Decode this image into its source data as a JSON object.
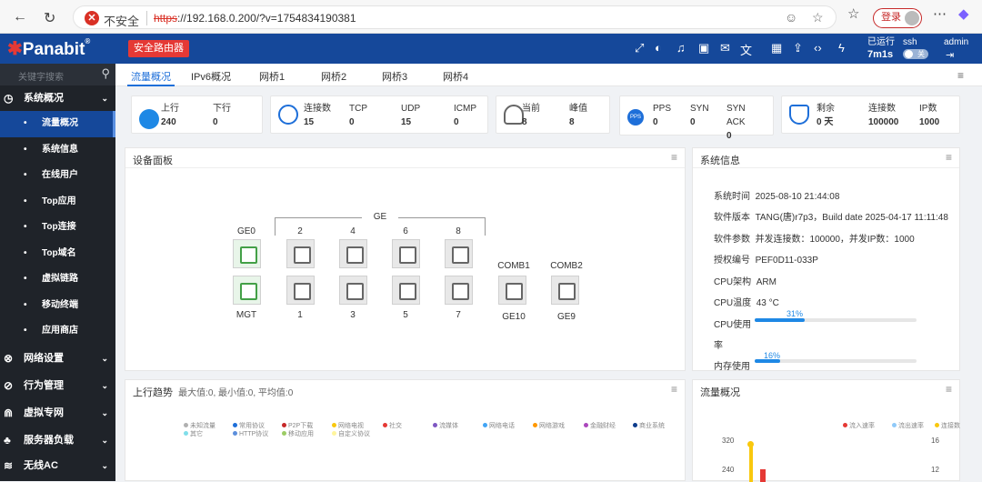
{
  "browser": {
    "insecure_label": "不安全",
    "url_scheme": "https",
    "url_rest": "://192.168.0.200/?v=1754834190381",
    "login_label": "登录"
  },
  "header": {
    "logo": "Panabit",
    "logo_mark": "®",
    "secure_router": "安全路由器",
    "uptime_label": "已运行",
    "uptime_value": "7m1s",
    "ssh_label": "ssh",
    "ssh_toggle": "关",
    "user": "admin"
  },
  "sidebar": {
    "search_placeholder": "关键字搜索",
    "groups": [
      {
        "label": "系统概况",
        "items": [
          "流量概况",
          "系统信息",
          "在线用户",
          "Top应用",
          "Top连接",
          "Top域名",
          "虚拟链路",
          "移动终端",
          "应用商店"
        ]
      },
      {
        "label": "网络设置"
      },
      {
        "label": "行为管理"
      },
      {
        "label": "虚拟专网"
      },
      {
        "label": "服务器负载"
      },
      {
        "label": "无线AC"
      }
    ]
  },
  "tabs": [
    "流量概况",
    "IPv6概况",
    "网桥1",
    "网桥2",
    "网桥3",
    "网桥4"
  ],
  "stats": {
    "traffic": {
      "up_label": "上行",
      "up_value": "240",
      "down_label": "下行",
      "down_value": "0"
    },
    "connections": {
      "conn_label": "连接数",
      "conn_value": "15",
      "tcp_label": "TCP",
      "tcp_value": "0",
      "udp_label": "UDP",
      "udp_value": "15",
      "icmp_label": "ICMP",
      "icmp_value": "0"
    },
    "users": {
      "current_label": "当前",
      "current_value": "8",
      "peak_label": "峰值",
      "peak_value": "8"
    },
    "pps": {
      "pps_label": "PPS",
      "pps_value": "0",
      "syn_label": "SYN",
      "syn_value": "0",
      "synack_label": "SYN ACK",
      "synack_value": "0"
    },
    "license": {
      "remain_label": "剩余",
      "remain_value": "0 天",
      "conn_label": "连接数",
      "conn_value": "100000",
      "ip_label": "IP数",
      "ip_value": "1000"
    }
  },
  "device_panel": {
    "title": "设备面板",
    "ge_label": "GE",
    "top_ports": [
      "GE0",
      "2",
      "4",
      "6",
      "8"
    ],
    "bottom_ports": [
      "MGT",
      "1",
      "3",
      "5",
      "7"
    ],
    "comb_labels": [
      "COMB1",
      "COMB2"
    ],
    "comb_ports": [
      "GE10",
      "GE9"
    ]
  },
  "system_info": {
    "title": "系统信息",
    "rows": [
      {
        "label": "系统时间",
        "value": "2025-08-10 21:44:08"
      },
      {
        "label": "软件版本",
        "value": "TANG(唐)r7p3，Build date 2025-04-17 11:11:48"
      },
      {
        "label": "软件参数",
        "value": "并发连接数：100000，并发IP数：1000"
      },
      {
        "label": "授权编号",
        "value": "PEF0D11-033P"
      },
      {
        "label": "CPU架构",
        "value": "ARM"
      },
      {
        "label": "CPU温度",
        "value": "43 °C"
      }
    ],
    "cpu_label_1": "CPU使用",
    "cpu_label_2": "率",
    "cpu_percent": "31%",
    "cpu_fraction": 0.31,
    "mem_label": "内存使用",
    "mem_percent": "16%",
    "mem_fraction": 0.16
  },
  "trend_panel": {
    "title": "上行趋势",
    "summary": "最大值:0, 最小值:0, 平均值:0",
    "legend": [
      {
        "name": "未知流量",
        "color": "#b0b0b0"
      },
      {
        "name": "常用协议",
        "color": "#1e6fd9"
      },
      {
        "name": "P2P下载",
        "color": "#c62828"
      },
      {
        "name": "网络电视",
        "color": "#f9c80e"
      },
      {
        "name": "社交",
        "color": "#e53935"
      },
      {
        "name": "流媒体",
        "color": "#7e57c2"
      },
      {
        "name": "网络电话",
        "color": "#42a5f5"
      },
      {
        "name": "网络游戏",
        "color": "#ff9800"
      },
      {
        "name": "金融财经",
        "color": "#ab47bc"
      },
      {
        "name": "商业系统",
        "color": "#0d3c8c"
      },
      {
        "name": "其它",
        "color": "#80deea"
      },
      {
        "name": "HTTP协议",
        "color": "#5c8fdc"
      },
      {
        "name": "移动应用",
        "color": "#9ccc65"
      },
      {
        "name": "自定义协议",
        "color": "#fff59d"
      }
    ]
  },
  "flow_panel": {
    "title": "流量概况",
    "legend": [
      {
        "name": "流入速率",
        "color": "#e53935"
      },
      {
        "name": "流出速率",
        "color": "#90caf9"
      },
      {
        "name": "连接数",
        "color": "#f9c80e"
      }
    ],
    "left_axis": [
      "320",
      "240"
    ],
    "right_axis": [
      "16",
      "12"
    ]
  }
}
